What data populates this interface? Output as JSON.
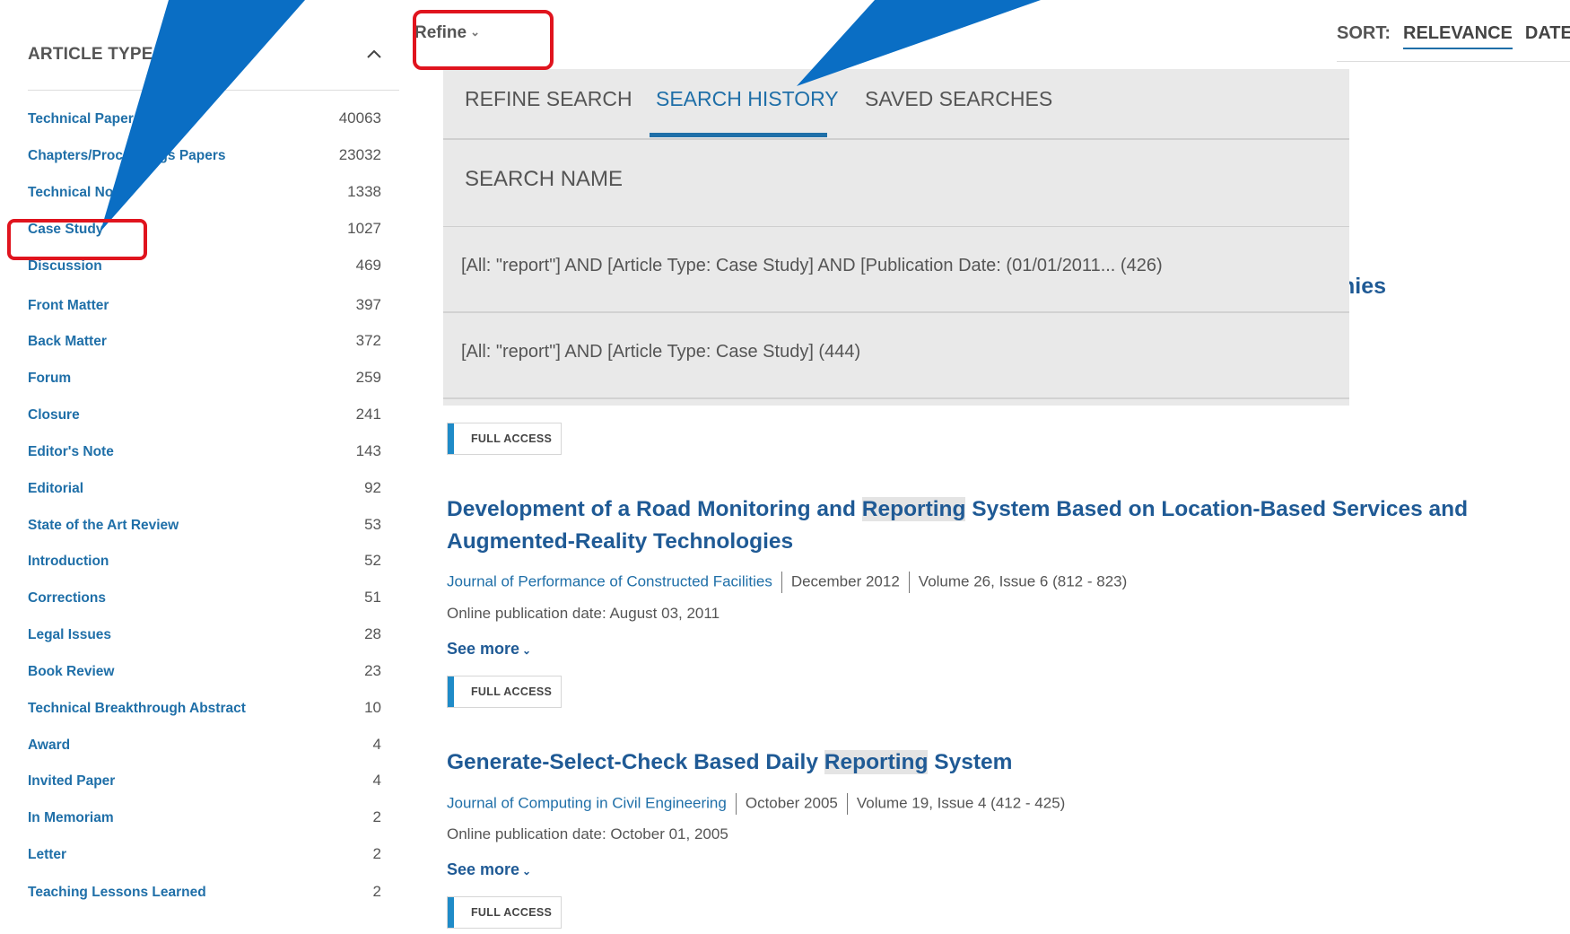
{
  "sidebar": {
    "header": "ARTICLE TYPE",
    "items": [
      {
        "label": "Technical Papers",
        "count": "40063"
      },
      {
        "label": "Chapters/Proceedings Papers",
        "count": "23032"
      },
      {
        "label": "Technical Note",
        "count": "1338"
      },
      {
        "label": "Case Study",
        "count": "1027"
      },
      {
        "label": "Discussion",
        "count": "469"
      },
      {
        "label": "Front Matter",
        "count": "397"
      },
      {
        "label": "Back Matter",
        "count": "372"
      },
      {
        "label": "Forum",
        "count": "259"
      },
      {
        "label": "Closure",
        "count": "241"
      },
      {
        "label": "Editor's Note",
        "count": "143"
      },
      {
        "label": "Editorial",
        "count": "92"
      },
      {
        "label": "State of the Art Review",
        "count": "53"
      },
      {
        "label": "Introduction",
        "count": "52"
      },
      {
        "label": "Corrections",
        "count": "51"
      },
      {
        "label": "Legal Issues",
        "count": "28"
      },
      {
        "label": "Book Review",
        "count": "23"
      },
      {
        "label": "Technical Breakthrough Abstract",
        "count": "10"
      },
      {
        "label": "Award",
        "count": "4"
      },
      {
        "label": "Invited Paper",
        "count": "4"
      },
      {
        "label": "In Memoriam",
        "count": "2"
      },
      {
        "label": "Letter",
        "count": "2"
      },
      {
        "label": "Teaching Lessons Learned",
        "count": "2"
      }
    ]
  },
  "toolbar": {
    "refine_label": "Refine",
    "sort_label": "SORT:",
    "sort_options": [
      "RELEVANCE",
      "DATE"
    ]
  },
  "panel": {
    "tabs": [
      "REFINE SEARCH",
      "SEARCH HISTORY",
      "SAVED SEARCHES"
    ],
    "search_name_header": "SEARCH NAME",
    "history": [
      "[All: \"report\"] AND [Article Type: Case Study] AND [Publication Date: (01/01/2011... (426)",
      "[All: \"report\"] AND [Article Type: Case Study] (444)"
    ]
  },
  "peek_title": "nies",
  "results": [
    {
      "badge": "FULL ACCESS"
    },
    {
      "title_pre": "Development of a Road Monitoring and ",
      "title_hl": "Reporting",
      "title_post": " System Based on Location-Based Services and Augmented-Reality Technologies",
      "journal": "Journal of Performance of Constructed Facilities",
      "date": "December 2012",
      "volume": "Volume 26, Issue 6 (812 - 823)",
      "online": "Online publication date: August 03, 2011",
      "see_more": "See more",
      "badge": "FULL ACCESS"
    },
    {
      "title_pre": "Generate-Select-Check Based Daily ",
      "title_hl": "Reporting",
      "title_post": " System",
      "journal": "Journal of Computing in Civil Engineering",
      "date": "October 2005",
      "volume": "Volume 19, Issue 4 (412 - 425)",
      "online": "Online publication date: October 01, 2005",
      "see_more": "See more",
      "badge": "FULL ACCESS"
    }
  ],
  "colors": {
    "link": "#1f6fa8",
    "title": "#1f5a95",
    "accent_bar": "#1f8bc8",
    "annotation_blue": "#0a6ec4",
    "annotation_red": "#e0141e"
  }
}
